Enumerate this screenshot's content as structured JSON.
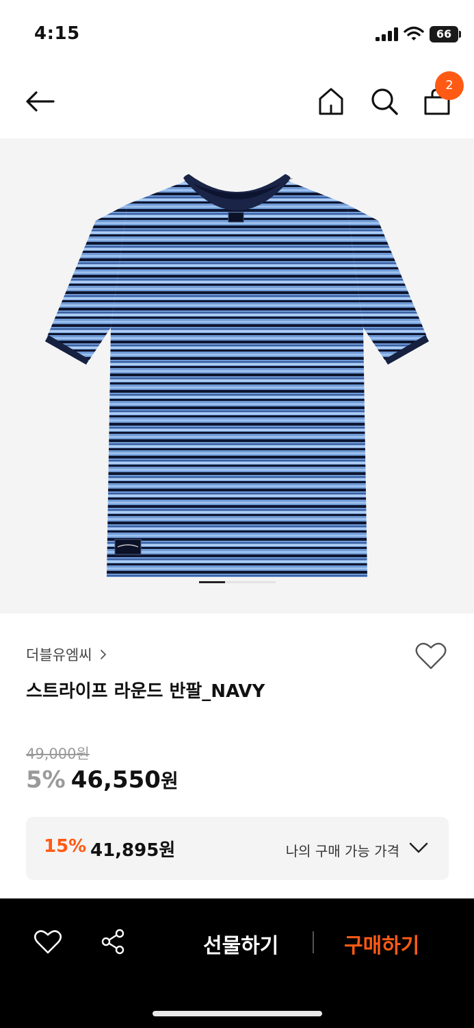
{
  "status_bar": {
    "time": "4:15",
    "battery": "66",
    "icons": [
      "signal-icon",
      "wifi-icon",
      "battery-icon"
    ]
  },
  "header": {
    "icons": [
      "back-arrow-icon",
      "home-icon",
      "search-icon",
      "shopping-bag-icon"
    ],
    "cart_count": "2"
  },
  "product": {
    "image_icon": "striped-tshirt-image",
    "image_page_current": 1,
    "brand": "더블유엠씨",
    "brand_chevron": "›",
    "name": "스트라이프 라운드 반팔_NAVY",
    "original_price": "49,000원",
    "discount_rate": "5%",
    "sale_price": "46,550",
    "sale_unit": "원"
  },
  "my_price": {
    "rate": "15%",
    "price": "41,895원",
    "label": "나의 구매 가능 가격"
  },
  "bottom_bar": {
    "gift_label": "선물하기",
    "buy_label": "구매하기",
    "icons": [
      "heart-icon",
      "share-icon"
    ]
  },
  "colors": {
    "accent": "#ff5a14",
    "bar_background": "#000000",
    "image_background": "#f4f4f4"
  }
}
